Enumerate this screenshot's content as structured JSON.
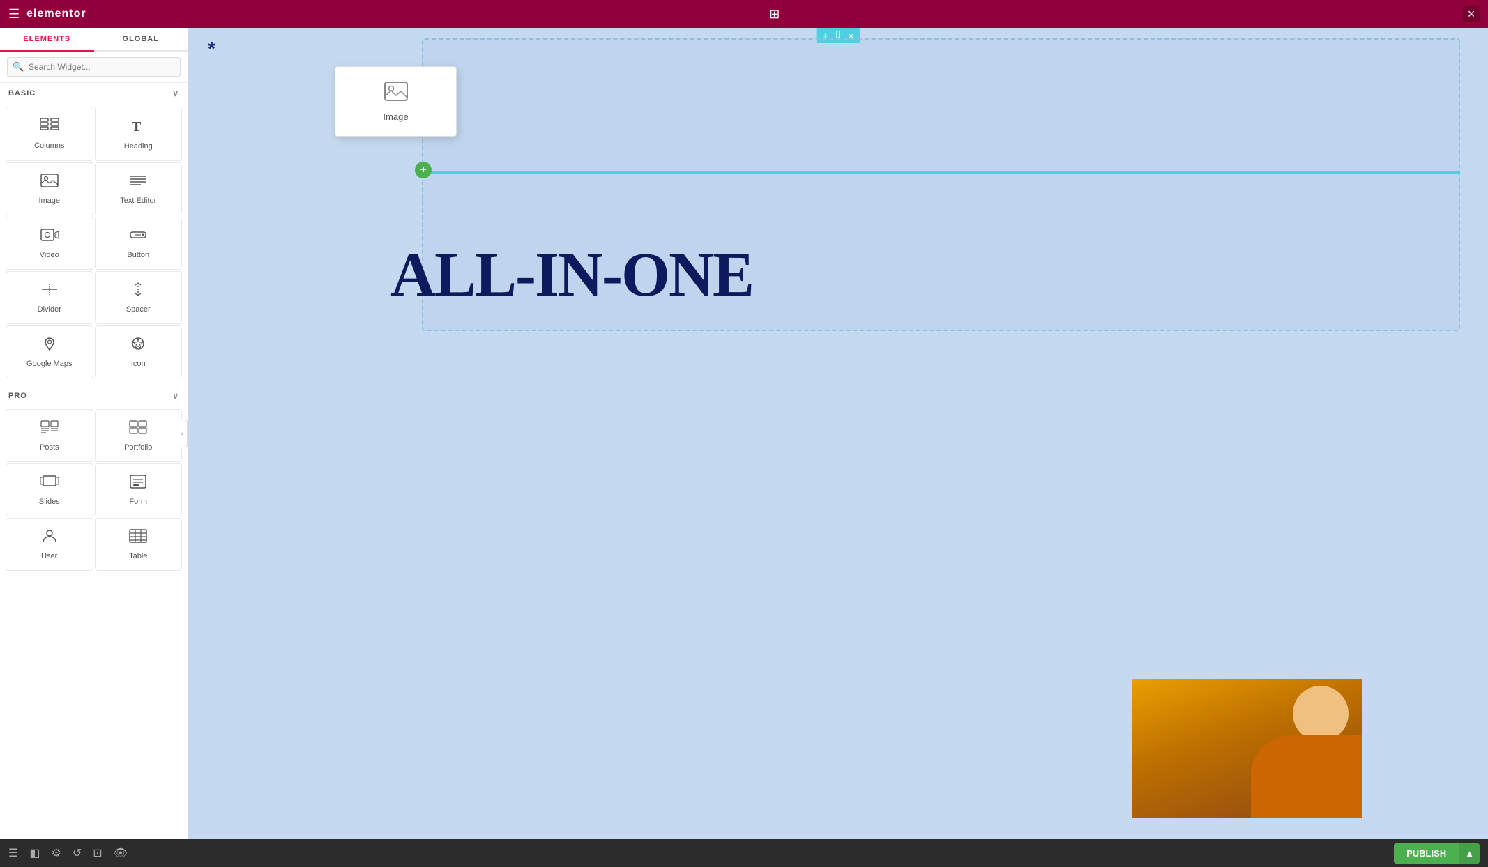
{
  "topbar": {
    "logo": "elementor",
    "close_label": "×"
  },
  "sidebar": {
    "tab_elements": "ELEMENTS",
    "tab_global": "GLOBAL",
    "search_placeholder": "Search Widget...",
    "section_basic": "BASIC",
    "section_pro": "PRO",
    "widgets_basic": [
      {
        "id": "columns",
        "label": "Columns",
        "icon": "columns"
      },
      {
        "id": "heading",
        "label": "Heading",
        "icon": "heading"
      },
      {
        "id": "image",
        "label": "Image",
        "icon": "image"
      },
      {
        "id": "text-editor",
        "label": "Text Editor",
        "icon": "text-editor"
      },
      {
        "id": "video",
        "label": "Video",
        "icon": "video"
      },
      {
        "id": "button",
        "label": "Button",
        "icon": "button"
      },
      {
        "id": "divider",
        "label": "Divider",
        "icon": "divider"
      },
      {
        "id": "spacer",
        "label": "Spacer",
        "icon": "spacer"
      },
      {
        "id": "google-maps",
        "label": "Google Maps",
        "icon": "google-maps"
      },
      {
        "id": "icon",
        "label": "Icon",
        "icon": "icon"
      }
    ],
    "widgets_pro": [
      {
        "id": "posts",
        "label": "Posts",
        "icon": "posts"
      },
      {
        "id": "portfolio",
        "label": "Portfolio",
        "icon": "portfolio"
      },
      {
        "id": "slides",
        "label": "Slides",
        "icon": "slides"
      },
      {
        "id": "form",
        "label": "Form",
        "icon": "form"
      },
      {
        "id": "user",
        "label": "User",
        "icon": "user"
      },
      {
        "id": "table",
        "label": "Table",
        "icon": "table"
      }
    ]
  },
  "canvas": {
    "drag_widget_label": "Image",
    "all_in_one_text": "ALL-IN-ONE",
    "asterisk": "*",
    "plus_btn": "+",
    "section_action_add": "+",
    "section_action_move": "⠿",
    "section_action_close": "×"
  },
  "bottombar": {
    "publish_label": "PUBLISH",
    "dropdown_label": "▲"
  }
}
